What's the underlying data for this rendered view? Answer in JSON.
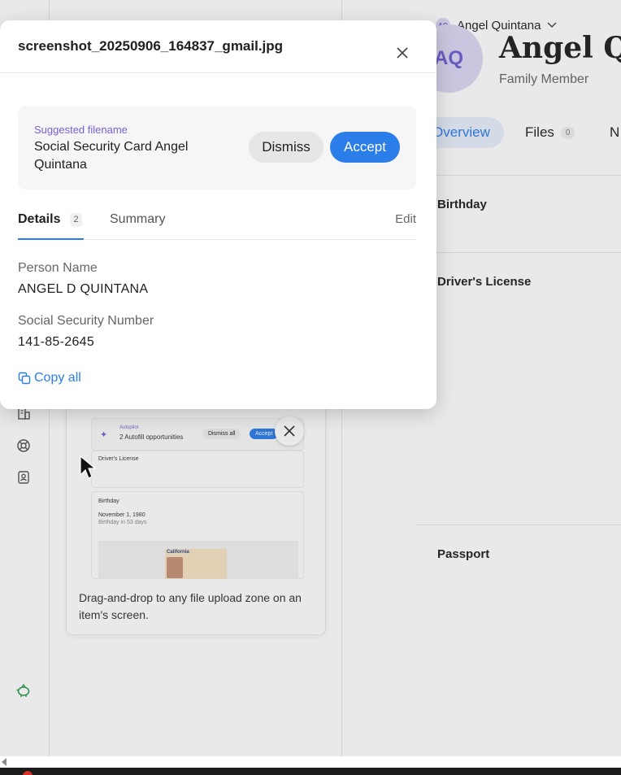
{
  "modal": {
    "title": "screenshot_20250906_164837_gmail.jpg",
    "suggestion": {
      "label": "Suggested filename",
      "value": "Social Security Card Angel Quintana",
      "dismiss_label": "Dismiss",
      "accept_label": "Accept"
    },
    "tabs": {
      "details_label": "Details",
      "details_count": "2",
      "summary_label": "Summary",
      "edit_label": "Edit"
    },
    "fields": [
      {
        "label": "Person Name",
        "value": "ANGEL D QUINTANA"
      },
      {
        "label": "Social Security Number",
        "value": "141-85-2645"
      }
    ],
    "copy_all_label": "Copy all"
  },
  "tip_card": {
    "preview": {
      "autopilot_label": "Autopilot",
      "opportunities": "2 Autofill opportunities",
      "dismiss_all": "Dismiss all",
      "accept": "Accept",
      "drivers_license": "Driver's License",
      "birthday_title": "Birthday",
      "birthday_date": "November 1, 1980",
      "birthday_note": "Birthday in 53 days",
      "license_state": "California"
    },
    "text": "Drag-and-drop to any file upload zone on an item's screen."
  },
  "profile": {
    "user_menu_name": "Angel Quintana",
    "initials": "AQ",
    "name": "Angel Quintana",
    "role": "Family Member",
    "tabs": {
      "overview": "Overview",
      "files": "Files",
      "files_count": "0",
      "next_tab": "N"
    },
    "sections": {
      "birthday": "Birthday",
      "drivers_license": "Driver's License",
      "passport": "Passport"
    }
  },
  "colors": {
    "accent": "#2b7de9",
    "suggest_label": "#7a5fd6",
    "avatar_bg": "#dcd8f4",
    "rail_green": "#2e9e4f"
  }
}
